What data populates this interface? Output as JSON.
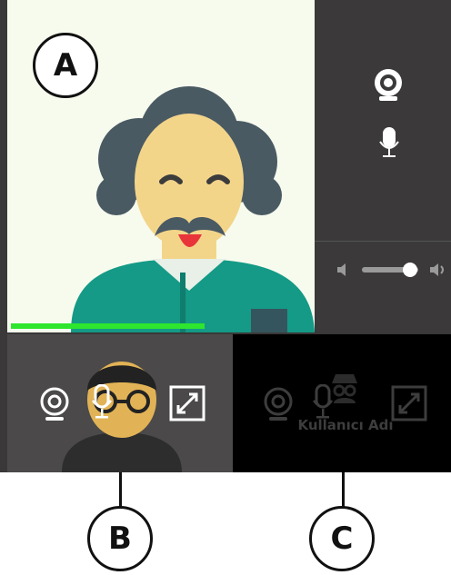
{
  "callouts": {
    "a": "A",
    "b": "B",
    "c": "C"
  },
  "participant_c": {
    "username": "Kullanıcı Adı"
  },
  "volume": {
    "level": 0.85
  },
  "connection_quality": {
    "level": 0.63
  },
  "colors": {
    "progress": "#2ee62e",
    "panel": "#3b3939",
    "main_bg": "#f7fbee"
  },
  "icons": {
    "side_camera": "webcam-icon",
    "side_mic": "microphone-icon",
    "vol_low": "speaker-low-icon",
    "vol_high": "speaker-high-icon",
    "b_camera": "webcam-icon",
    "b_mic": "microphone-icon",
    "b_expand": "expand-icon",
    "c_camera": "webcam-icon",
    "c_mic": "microphone-icon",
    "c_expand": "expand-icon",
    "c_avatar": "incognito-avatar-icon"
  }
}
